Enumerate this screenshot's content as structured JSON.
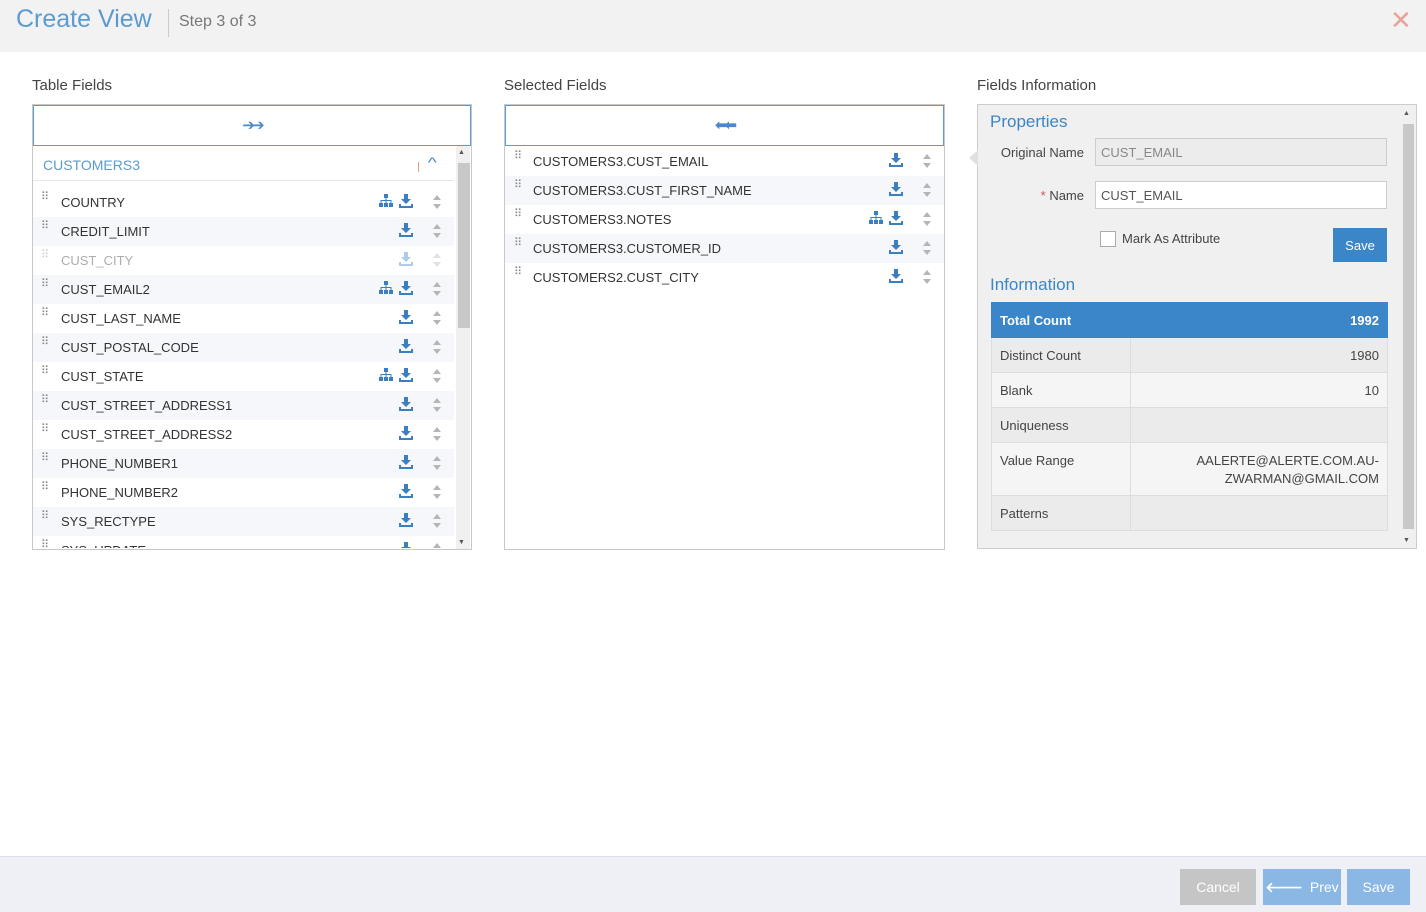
{
  "header": {
    "title": "Create View",
    "step": "Step 3 of 3"
  },
  "columns": {
    "table_fields": "Table Fields",
    "selected_fields": "Selected Fields",
    "fields_information": "Fields Information"
  },
  "table_fields": {
    "table_name": "CUSTOMERS3",
    "items": [
      {
        "label": "COUNTRY",
        "hierarchy": true,
        "dim": false
      },
      {
        "label": "CREDIT_LIMIT",
        "hierarchy": false,
        "dim": false
      },
      {
        "label": "CUST_CITY",
        "hierarchy": false,
        "dim": true
      },
      {
        "label": "CUST_EMAIL2",
        "hierarchy": true,
        "dim": false
      },
      {
        "label": "CUST_LAST_NAME",
        "hierarchy": false,
        "dim": false
      },
      {
        "label": "CUST_POSTAL_CODE",
        "hierarchy": false,
        "dim": false
      },
      {
        "label": "CUST_STATE",
        "hierarchy": true,
        "dim": false
      },
      {
        "label": "CUST_STREET_ADDRESS1",
        "hierarchy": false,
        "dim": false
      },
      {
        "label": "CUST_STREET_ADDRESS2",
        "hierarchy": false,
        "dim": false
      },
      {
        "label": "PHONE_NUMBER1",
        "hierarchy": false,
        "dim": false
      },
      {
        "label": "PHONE_NUMBER2",
        "hierarchy": false,
        "dim": false
      },
      {
        "label": "SYS_RECTYPE",
        "hierarchy": false,
        "dim": false
      },
      {
        "label": "SYS_UPDATE",
        "hierarchy": false,
        "dim": false
      }
    ]
  },
  "selected_fields": {
    "items": [
      {
        "label": "CUSTOMERS3.CUST_EMAIL",
        "hierarchy": false
      },
      {
        "label": "CUSTOMERS3.CUST_FIRST_NAME",
        "hierarchy": false
      },
      {
        "label": "CUSTOMERS3.NOTES",
        "hierarchy": true
      },
      {
        "label": "CUSTOMERS3.CUSTOMER_ID",
        "hierarchy": false
      },
      {
        "label": "CUSTOMERS2.CUST_CITY",
        "hierarchy": false
      }
    ]
  },
  "properties": {
    "title": "Properties",
    "original_name_label": "Original Name",
    "original_name_value": "CUST_EMAIL",
    "name_required_mark": "*",
    "name_label": "Name",
    "name_value": "CUST_EMAIL",
    "mark_as_attribute_label": "Mark As Attribute",
    "mark_as_attribute_checked": false,
    "save_label": "Save"
  },
  "information": {
    "title": "Information",
    "header": {
      "label": "Total Count",
      "value": "1992"
    },
    "rows": [
      {
        "label": "Distinct Count",
        "value": "1980"
      },
      {
        "label": "Blank",
        "value": "10"
      },
      {
        "label": "Uniqueness",
        "value": ""
      },
      {
        "label": "Value Range",
        "value_line1": "AALERTE@ALERTE.COM.AU-",
        "value_line2": "ZWARMAN@GMAIL.COM"
      },
      {
        "label": "Patterns",
        "value": ""
      }
    ]
  },
  "footer": {
    "cancel_label": "Cancel",
    "prev_label": "Prev",
    "save_label": "Save"
  },
  "colors": {
    "accent": "#3b86c8",
    "title_blue": "#5b9bd1",
    "close": "#e8a39a"
  },
  "icons": {
    "move_right": "double-arrow-right-icon",
    "move_left": "double-arrow-left-icon",
    "hierarchy": "sitemap-icon",
    "download": "download-icon",
    "sort": "sort-icon",
    "grip": "drag-handle-icon",
    "collapse": "chevron-up-icon",
    "close": "close-icon"
  }
}
